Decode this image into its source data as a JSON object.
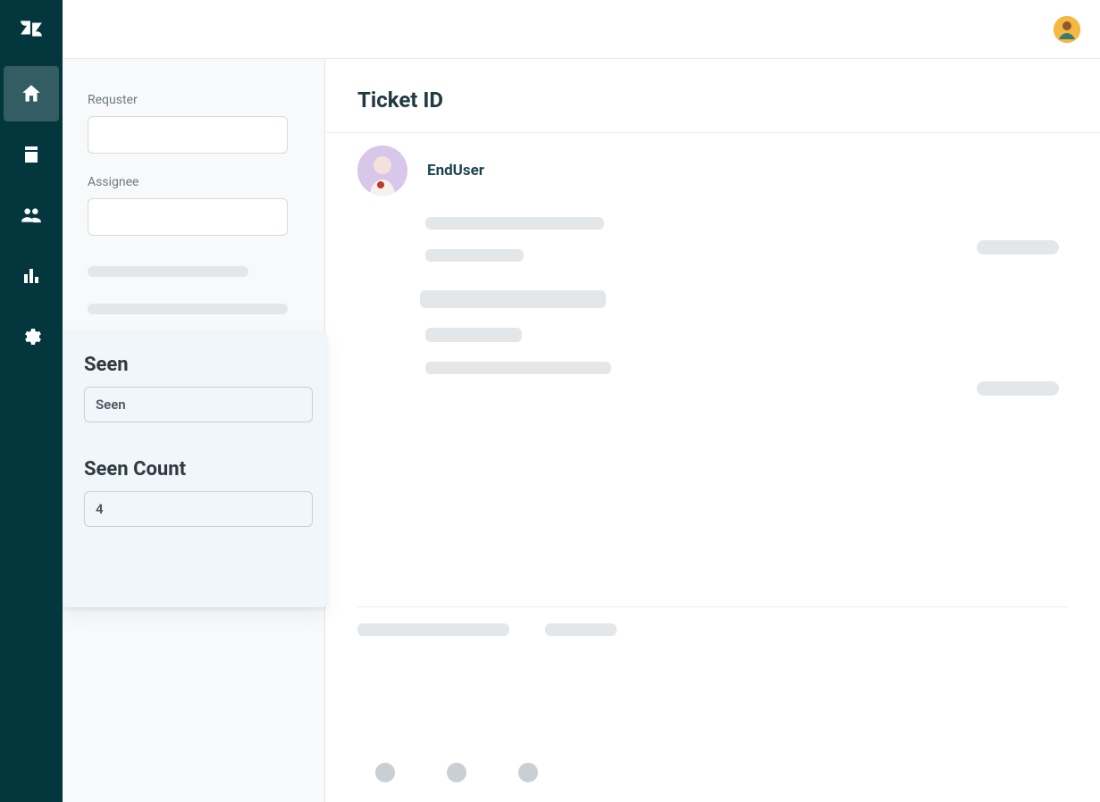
{
  "nav": {
    "items": [
      {
        "id": "home",
        "active": true
      },
      {
        "id": "views",
        "active": false
      },
      {
        "id": "customers",
        "active": false
      },
      {
        "id": "reporting",
        "active": false
      },
      {
        "id": "admin",
        "active": false
      }
    ]
  },
  "sidebar": {
    "requester_label": "Requster",
    "requester_value": "",
    "assignee_label": "Assignee",
    "assignee_value": ""
  },
  "app_card": {
    "seen_heading": "Seen",
    "seen_value": "Seen",
    "seen_count_heading": "Seen Count",
    "seen_count_value": "4"
  },
  "ticket": {
    "title": "Ticket  ID",
    "requester_name": "EndUser"
  }
}
